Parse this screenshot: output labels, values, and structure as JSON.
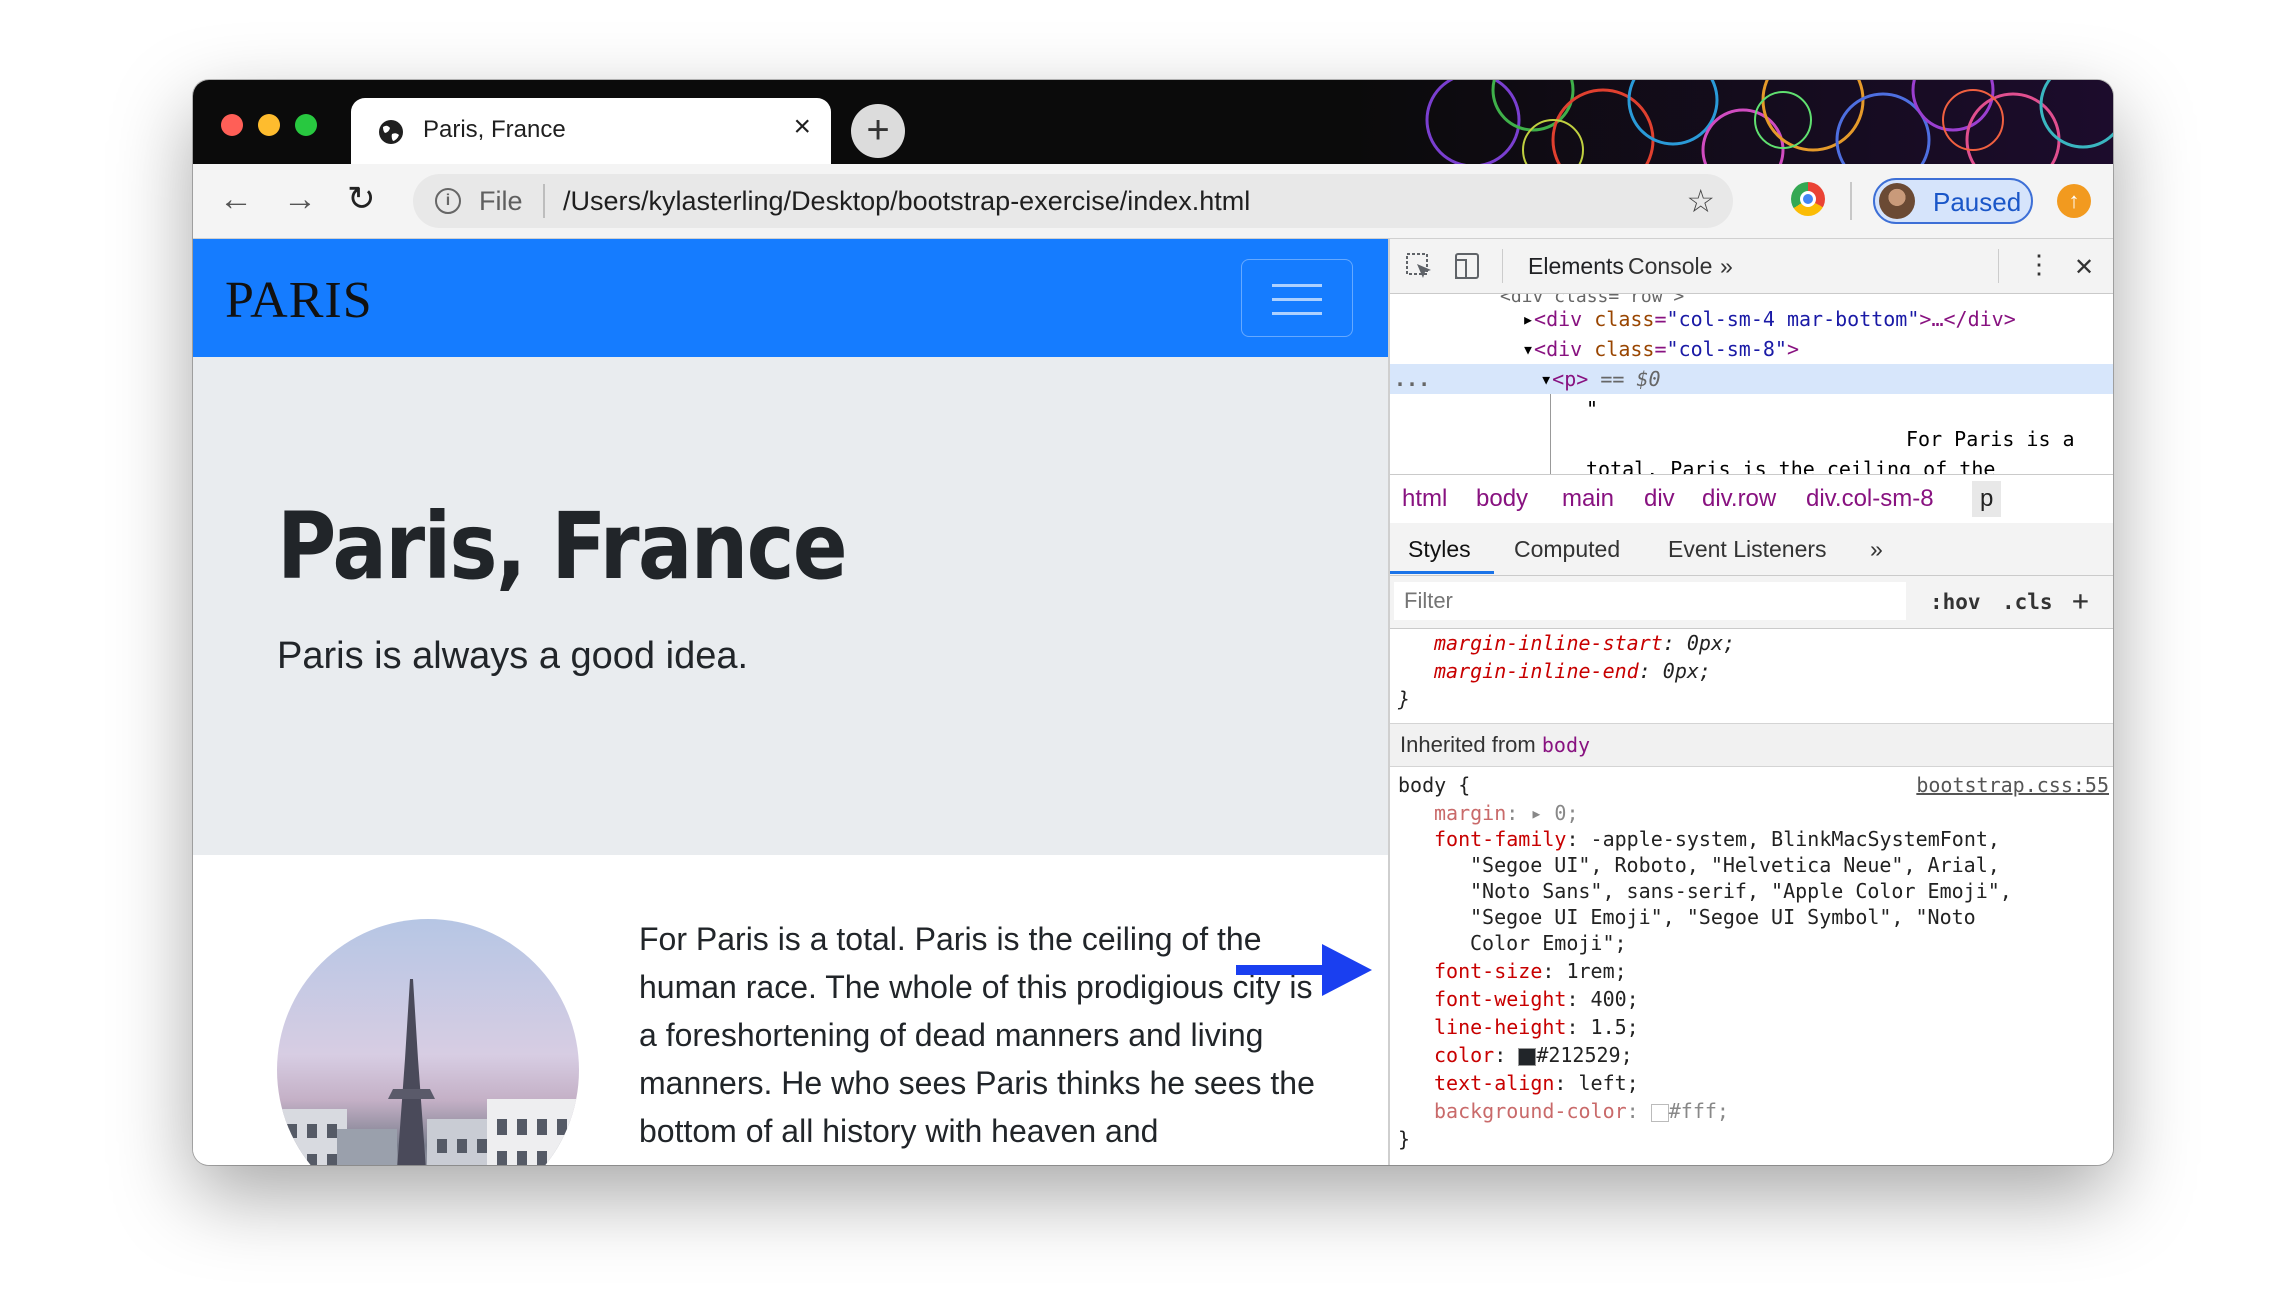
{
  "tab": {
    "title": "Paris, France",
    "close": "×",
    "new_tab": "+"
  },
  "toolbar": {
    "back": "←",
    "forward": "→",
    "reload": "↻",
    "scheme": "File",
    "url": "/Users/kylasterling/Desktop/bootstrap-exercise/index.html",
    "bookmark": "☆",
    "profile_status": "Paused",
    "update": "↑"
  },
  "page": {
    "brand": "PARIS",
    "heading": "Paris, France",
    "lead": "Paris is always a good idea.",
    "paragraph": "For Paris is a total. Paris is the ceiling of the human race. The whole of this prodigious city is a foreshortening of dead manners and living manners. He who sees Paris thinks he sees the bottom of all history with heaven and"
  },
  "devtools": {
    "tabs": [
      "Elements",
      "Console",
      "»"
    ],
    "more": "⋮",
    "close": "✕",
    "dom": {
      "line0": "<div class=\"row\">",
      "l1_tag_open": "<div",
      "l1_attr": "class",
      "l1_val": "\"col-sm-4 mar-bottom\"",
      "l1_rest": ">…</div>",
      "l2_tag_open": "<div",
      "l2_attr": "class",
      "l2_val": "\"col-sm-8\"",
      "l2_rest": ">",
      "l3_ellipsis": "...",
      "l3_tag": "<p>",
      "l3_sel": "== $0",
      "l4": "\"",
      "l5": "For Paris is a",
      "l6": "total. Paris is the ceiling of the"
    },
    "breadcrumbs": [
      "html",
      "body",
      "main",
      "div",
      "div.row",
      "div.col-sm-8",
      "p"
    ],
    "subtabs": [
      "Styles",
      "Computed",
      "Event Listeners",
      "»"
    ],
    "filter_placeholder": "Filter",
    "hov": ":hov",
    "cls": ".cls",
    "add": "+",
    "styles": {
      "margin_inline_start_prop": "margin-inline-start",
      "margin_inline_start_val": "0px;",
      "margin_inline_end_prop": "margin-inline-end",
      "margin_inline_end_val": "0px;",
      "close_brace": "}",
      "inherited_label": "Inherited from",
      "inherited_el": "body",
      "selector": "body {",
      "source": "bootstrap.css:55",
      "margin_prop": "margin",
      "margin_val": "0;",
      "font_family_prop": "font-family",
      "font_family_val_1": "-apple-system, BlinkMacSystemFont,",
      "font_family_val_2": "\"Segoe UI\", Roboto, \"Helvetica Neue\", Arial,",
      "font_family_val_3": "\"Noto Sans\", sans-serif, \"Apple Color Emoji\",",
      "font_family_val_4": "\"Segoe UI Emoji\", \"Segoe UI Symbol\", \"Noto",
      "font_family_val_5": "Color Emoji\";",
      "font_size_prop": "font-size",
      "font_size_val": "1rem;",
      "font_weight_prop": "font-weight",
      "font_weight_val": "400;",
      "line_height_prop": "line-height",
      "line_height_val": "1.5;",
      "color_prop": "color",
      "color_val": "#212529;",
      "text_align_prop": "text-align",
      "text_align_val": "left;",
      "bg_prop": "background-color",
      "bg_val": "#fff;"
    }
  },
  "colors": {
    "navbar": "#157cff",
    "jumbotron": "#e9ecef",
    "text": "#212529",
    "arrow": "#1a3ff0",
    "paused_text": "#1a56c8"
  },
  "icons": {
    "site": "globe-icon",
    "inspect": "inspect-element-icon",
    "device": "device-toolbar-icon",
    "info": "info-icon"
  }
}
